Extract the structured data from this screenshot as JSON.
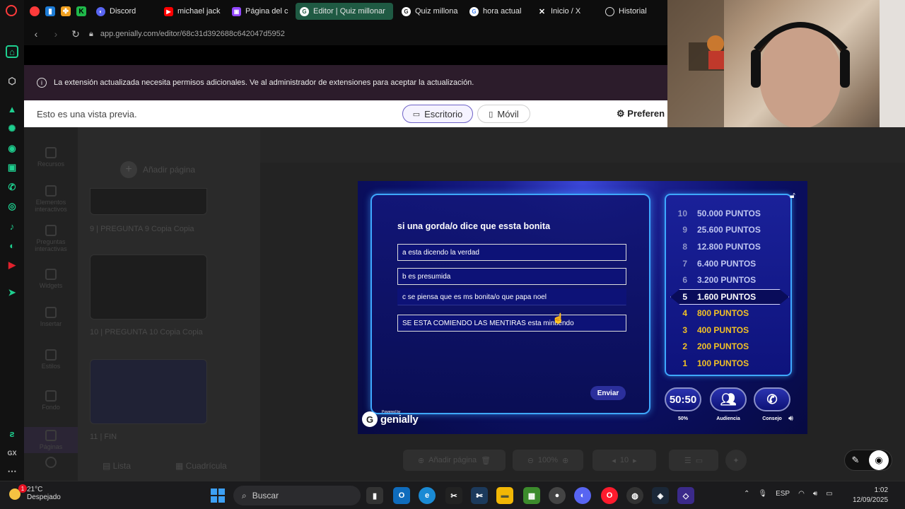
{
  "browser": {
    "tabs": [
      {
        "label": "Discord",
        "icon": "discord-icon",
        "color": "#5865f2"
      },
      {
        "label": "michael jack",
        "icon": "youtube-icon",
        "color": "#ff0000"
      },
      {
        "label": "Página del c",
        "icon": "twitch-icon",
        "color": "#9146ff"
      },
      {
        "label": "Editor | Quiz millonar",
        "icon": "genially-icon",
        "color": "#ffffff",
        "active": true
      },
      {
        "label": "Quiz millona",
        "icon": "genially-icon",
        "color": "#ffffff"
      },
      {
        "label": "hora actual",
        "icon": "google-icon",
        "color": "#ffffff"
      },
      {
        "label": "Inicio / X",
        "icon": "x-icon",
        "color": "#ffffff"
      },
      {
        "label": "Historial",
        "icon": "history-icon",
        "color": "#ffffff"
      }
    ],
    "url": "app.genially.com/editor/68c31d392688c642047d5952",
    "notice": "La extensión actualizada necesita permisos adicionales. Ve al administrador de extensiones para aceptar la actualización."
  },
  "preview": {
    "text": "Esto es una vista previa.",
    "desktop_label": "Escritorio",
    "mobile_label": "Móvil",
    "prefs_label": "Preferen"
  },
  "editor": {
    "add_page": "Añadir página",
    "rail": [
      "Recursos",
      "Elementos interactivos",
      "Preguntas interactivas",
      "Widgets",
      "Insertar",
      "Estilos",
      "Fondo",
      "Páginas"
    ],
    "pages": [
      {
        "label": "9 | PREGUNTA 9 Copia Copia"
      },
      {
        "label": "10 | PREGUNTA 10 Copia Copia"
      },
      {
        "label": "11 | FIN"
      }
    ],
    "list_label": "Lista",
    "grid_label": "Cuadrícula",
    "bottom_add_page": "Añadir página",
    "zoom": "100%",
    "page_number": "10"
  },
  "quiz": {
    "question": "si una gorda/o dice que essta bonita",
    "answers": [
      "a esta dicendo la verdad",
      "b es presumida",
      "c se piensa que es ms bonita/o que papa noel",
      "SE ESTA COMIENDO LAS MENTIRAS esta mintiendo"
    ],
    "send_label": "Enviar",
    "ladder": [
      {
        "num": "10",
        "points": "50.000 PUNTOS"
      },
      {
        "num": "9",
        "points": "25.600 PUNTOS"
      },
      {
        "num": "8",
        "points": "12.800 PUNTOS"
      },
      {
        "num": "7",
        "points": "6.400 PUNTOS"
      },
      {
        "num": "6",
        "points": "3.200 PUNTOS"
      },
      {
        "num": "5",
        "points": "1.600 PUNTOS"
      },
      {
        "num": "4",
        "points": "800 PUNTOS"
      },
      {
        "num": "3",
        "points": "400 PUNTOS"
      },
      {
        "num": "2",
        "points": "200 PUNTOS"
      },
      {
        "num": "1",
        "points": "100 PUNTOS"
      }
    ],
    "current_level": "5",
    "lifelines": {
      "fifty": {
        "value": "50:50",
        "label": "50%"
      },
      "audience": {
        "label": "Audiencia"
      },
      "phone": {
        "label": "Consejo"
      }
    },
    "brand": "genially",
    "brand_small": "Powered by"
  },
  "taskbar": {
    "temp": "21°C",
    "weather": "Despejado",
    "weather_badge": "1",
    "search_placeholder": "Buscar",
    "lang": "ESP",
    "time": "1:02",
    "date": "12/09/2025"
  },
  "colors": {
    "accent": "#3ea8ff",
    "gold": "#f2c224",
    "active_tab": "#1f5a43"
  }
}
